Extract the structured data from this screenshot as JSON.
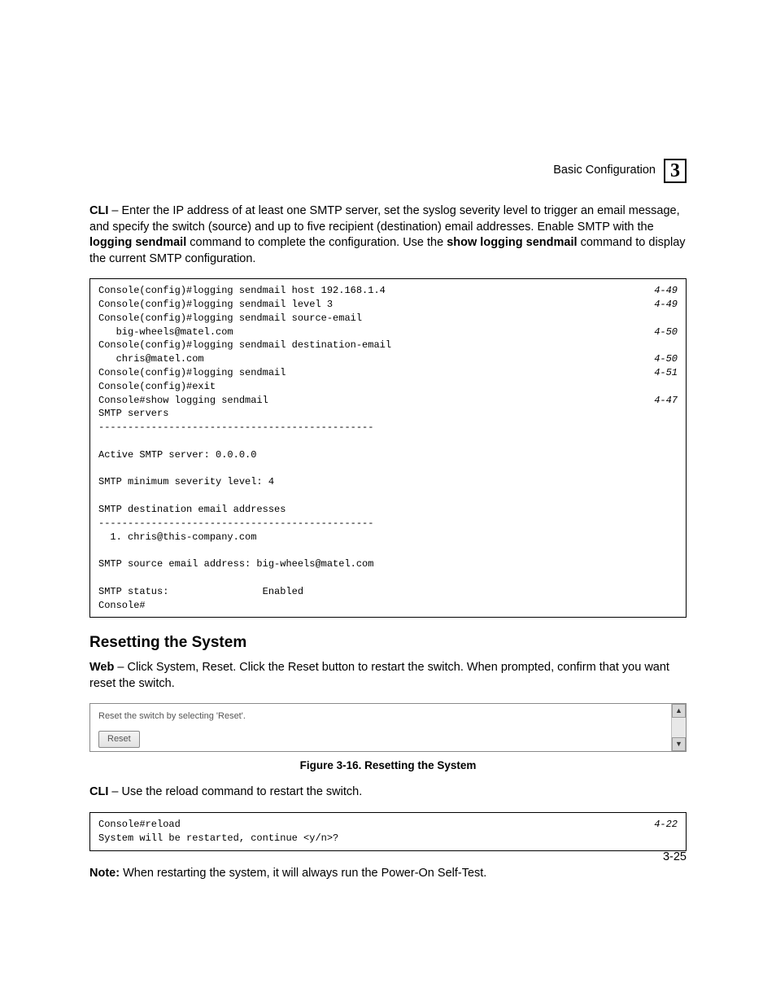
{
  "header": {
    "section": "Basic Configuration",
    "chapter": "3"
  },
  "intro": {
    "cli_label": "CLI",
    "p1a": " – Enter the IP address of at least one SMTP server, set the syslog severity level to trigger an email message, and specify the switch (source) and up to five recipient (destination) email addresses. Enable SMTP with the ",
    "cmd1": "logging sendmail",
    "p1b": " command to complete the configuration. Use the ",
    "cmd2": "show logging sendmail",
    "p1c": " command to display the current SMTP configuration."
  },
  "code1": {
    "rows": [
      {
        "t": "Console(config)#logging sendmail host 192.168.1.4",
        "r": "4-49"
      },
      {
        "t": "Console(config)#logging sendmail level 3",
        "r": "4-49"
      },
      {
        "t": "Console(config)#logging sendmail source-email",
        "r": ""
      },
      {
        "t": "   big-wheels@matel.com",
        "r": "4-50"
      },
      {
        "t": "Console(config)#logging sendmail destination-email",
        "r": ""
      },
      {
        "t": "   chris@matel.com",
        "r": "4-50"
      },
      {
        "t": "Console(config)#logging sendmail",
        "r": "4-51"
      },
      {
        "t": "Console(config)#exit",
        "r": ""
      },
      {
        "t": "Console#show logging sendmail",
        "r": "4-47"
      },
      {
        "t": "SMTP servers",
        "r": ""
      },
      {
        "t": "-----------------------------------------------",
        "r": ""
      },
      {
        "t": "",
        "r": ""
      },
      {
        "t": "Active SMTP server: 0.0.0.0",
        "r": ""
      },
      {
        "t": "",
        "r": ""
      },
      {
        "t": "SMTP minimum severity level: 4",
        "r": ""
      },
      {
        "t": "",
        "r": ""
      },
      {
        "t": "SMTP destination email addresses",
        "r": ""
      },
      {
        "t": "-----------------------------------------------",
        "r": ""
      },
      {
        "t": "  1. chris@this-company.com",
        "r": ""
      },
      {
        "t": "",
        "r": ""
      },
      {
        "t": "SMTP source email address: big-wheels@matel.com",
        "r": ""
      },
      {
        "t": "",
        "r": ""
      },
      {
        "t": "SMTP status:                Enabled",
        "r": ""
      },
      {
        "t": "Console#",
        "r": ""
      }
    ]
  },
  "reset": {
    "heading": "Resetting the System",
    "web_label": "Web",
    "web_text": " – Click System, Reset. Click the Reset button to restart the switch. When prompted, confirm that you want reset the switch.",
    "instr": "Reset the switch by selecting 'Reset'.",
    "button": "Reset",
    "caption": "Figure 3-16.  Resetting the System",
    "cli_label": "CLI",
    "cli_text": " – Use the reload command to restart the switch."
  },
  "code2": {
    "rows": [
      {
        "t": "Console#reload",
        "r": "4-22"
      },
      {
        "t": "System will be restarted, continue <y/n>?",
        "r": ""
      }
    ]
  },
  "note": {
    "label": "Note:",
    "text": "  When restarting the system, it will always run the Power-On Self-Test."
  },
  "page_number": "3-25"
}
